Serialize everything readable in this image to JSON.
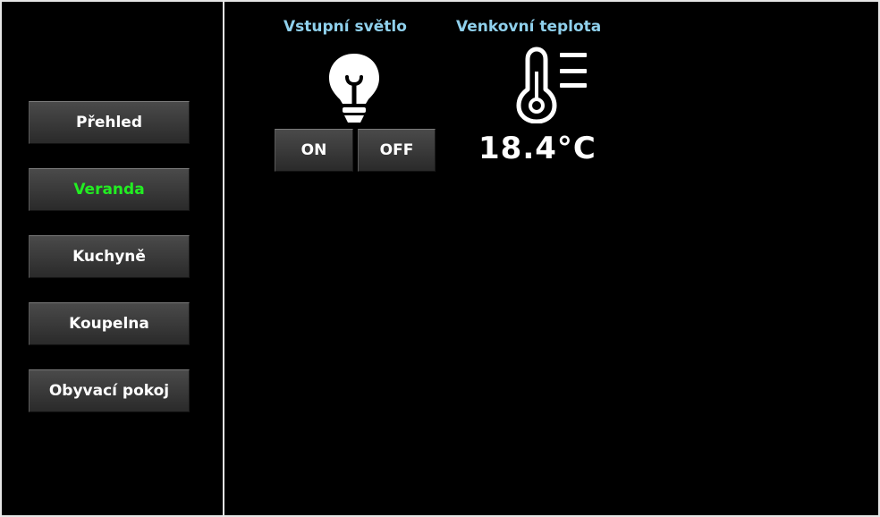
{
  "sidebar": {
    "items": [
      {
        "label": "Přehled",
        "active": false
      },
      {
        "label": "Veranda",
        "active": true
      },
      {
        "label": "Kuchyně",
        "active": false
      },
      {
        "label": "Koupelna",
        "active": false
      },
      {
        "label": "Obyvací pokoj",
        "active": false
      }
    ],
    "active_color": "#22ee22"
  },
  "light_widget": {
    "title": "Vstupní světlo",
    "icon": "lightbulb-icon",
    "on_label": "ON",
    "off_label": "OFF"
  },
  "temp_widget": {
    "title": "Venkovní teplota",
    "icon": "thermometer-icon",
    "value": "18.4°C"
  },
  "colors": {
    "background": "#000000",
    "title": "#8fd0ec",
    "border": "#e6e6e6"
  }
}
